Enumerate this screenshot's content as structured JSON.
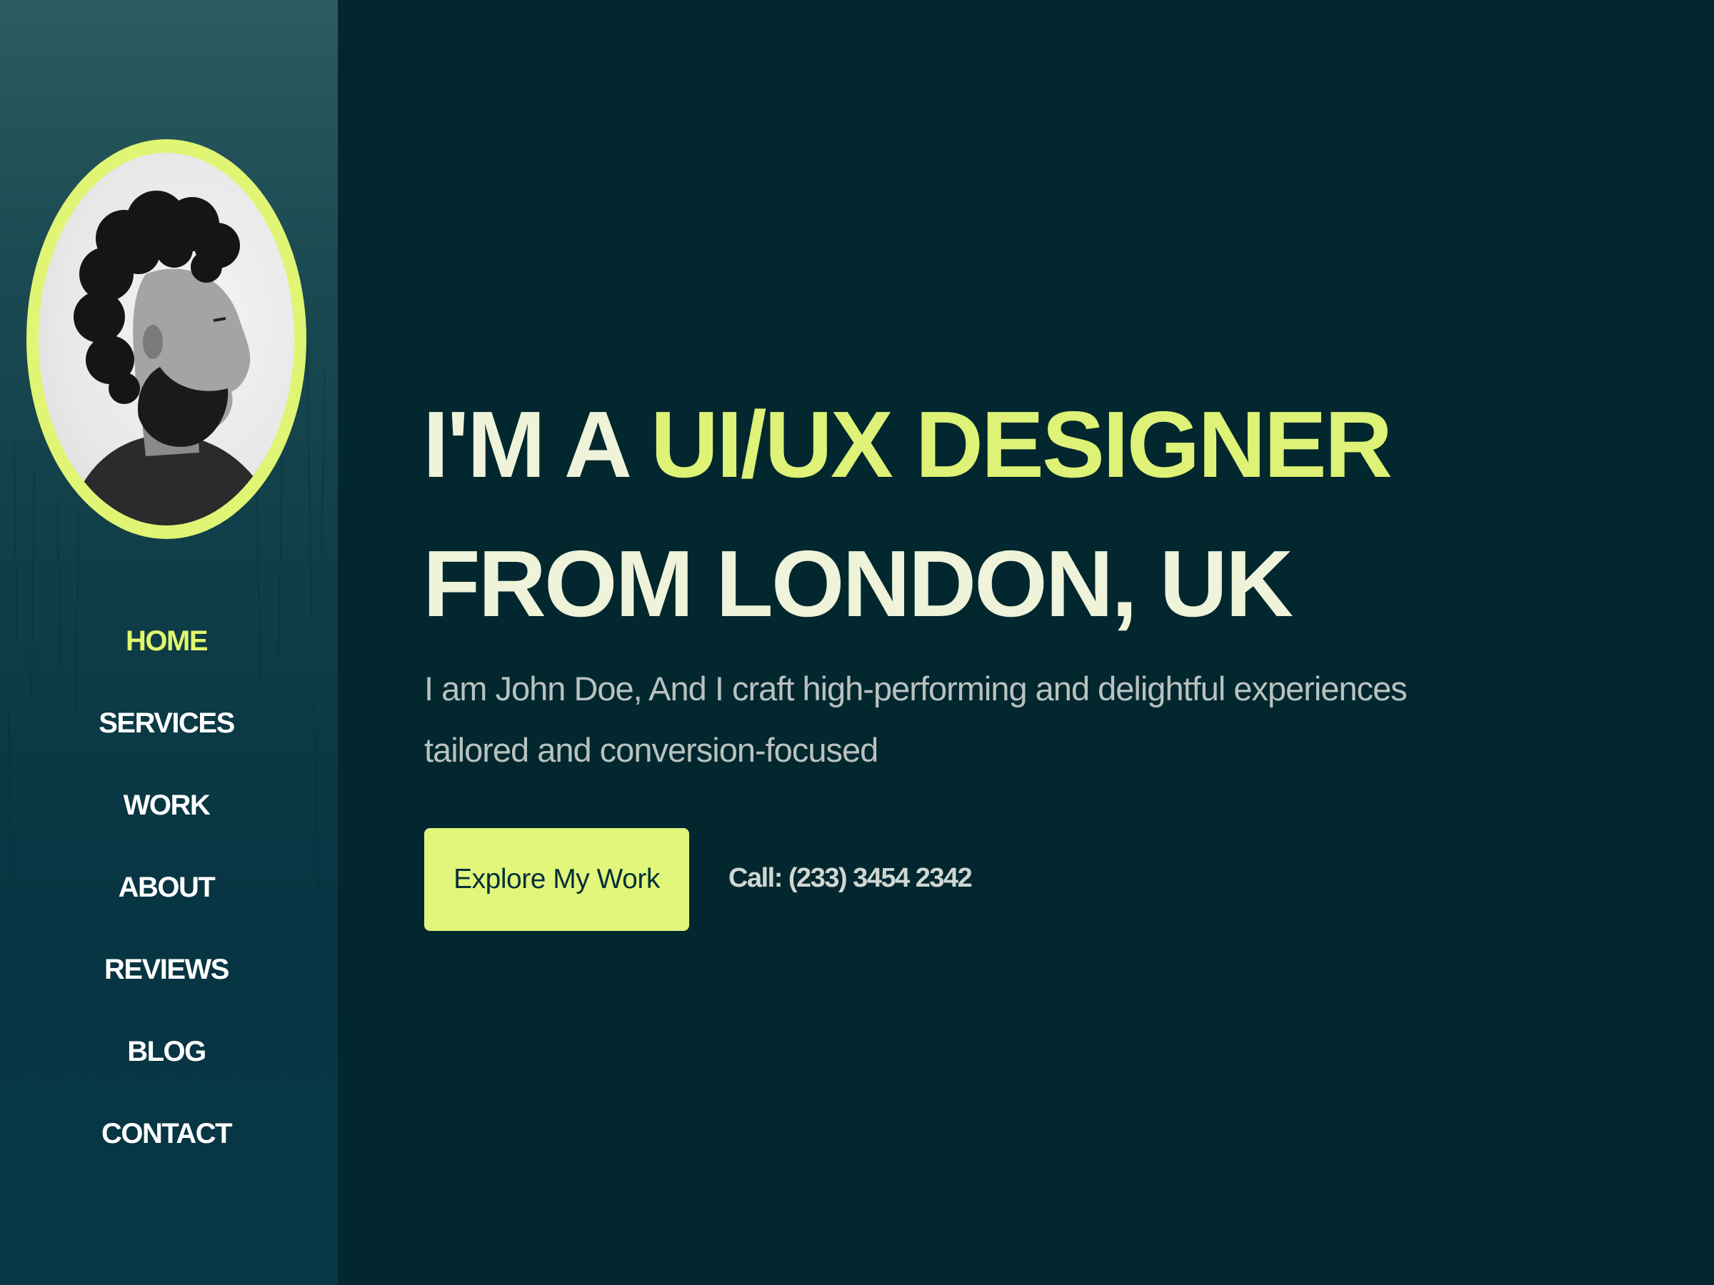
{
  "colors": {
    "background": "#03272f",
    "accent": "#e1f66e",
    "headline_text": "#eef3d9",
    "subtitle_text": "#b8c2bf",
    "nav_text": "#ffffff"
  },
  "sidebar": {
    "avatar_icon": "profile-photo",
    "nav": [
      {
        "label": "HOME",
        "active": true
      },
      {
        "label": "SERVICES",
        "active": false
      },
      {
        "label": "WORK",
        "active": false
      },
      {
        "label": "ABOUT",
        "active": false
      },
      {
        "label": "REVIEWS",
        "active": false
      },
      {
        "label": "BLOG",
        "active": false
      },
      {
        "label": "CONTACT",
        "active": false
      }
    ]
  },
  "hero": {
    "headline_part1": "I'M A ",
    "headline_accent": "UI/UX DESIGNER",
    "headline_part2": "FROM LONDON, UK",
    "subtitle": "I am John Doe, And I craft high-performing and delightful experiences tailored and conversion-focused",
    "cta_label": "Explore My Work",
    "phone": "Call: (233) 3454 2342"
  }
}
